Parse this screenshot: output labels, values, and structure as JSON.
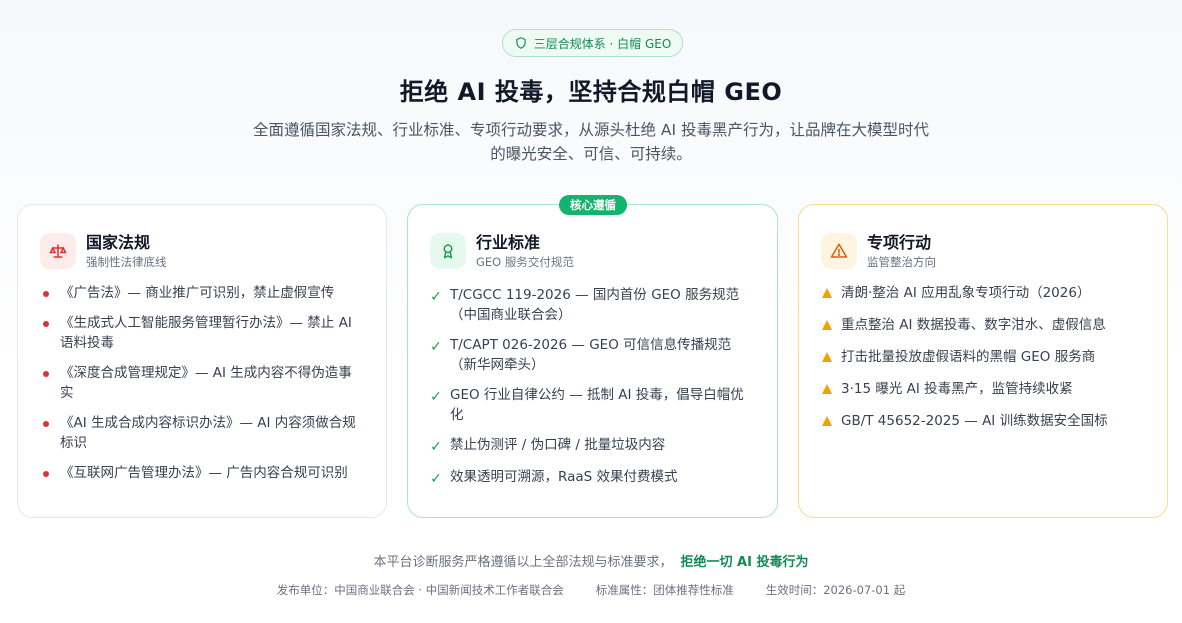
{
  "badge": {
    "icon": "shield-icon",
    "label": "三层合规体系 · 白帽 GEO"
  },
  "hero": {
    "title": "拒绝 AI 投毒，坚持合规白帽 GEO",
    "subtitle": "全面遵循国家法规、行业标准、专项行动要求，从源头杜绝 AI 投毒黑产行为，让品牌在大模型时代的曝光安全、可信、可持续。"
  },
  "cards": [
    {
      "icon": "scale-icon",
      "title": "国家法规",
      "subtitle": "强制性法律底线",
      "items": [
        "《广告法》— 商业推广可识别，禁止虚假宣传",
        "《生成式人工智能服务管理暂行办法》— 禁止 AI 语料投毒",
        "《深度合成管理规定》— AI 生成内容不得伪造事实",
        "《AI 生成合成内容标识办法》— AI 内容须做合规标识",
        "《互联网广告管理办法》— 广告内容合规可识别"
      ]
    },
    {
      "badge": "核心遵循",
      "icon": "award-icon",
      "title": "行业标准",
      "subtitle": "GEO 服务交付规范",
      "items": [
        "T/CGCC 119-2026 — 国内首份 GEO 服务规范（中国商业联合会）",
        "T/CAPT 026-2026 — GEO 可信信息传播规范（新华网牵头）",
        "GEO 行业自律公约 — 抵制 AI 投毒，倡导白帽优化",
        "禁止伪测评 / 伪口碑 / 批量垃圾内容",
        "效果透明可溯源，RaaS 效果付费模式"
      ]
    },
    {
      "icon": "warning-icon",
      "title": "专项行动",
      "subtitle": "监管整治方向",
      "items": [
        "清朗·整治 AI 应用乱象专项行动（2026）",
        "重点整治 AI 数据投毒、数字泔水、虚假信息",
        "打击批量投放虚假语料的黑帽 GEO 服务商",
        "3·15 曝光 AI 投毒黑产，监管持续收紧",
        "GB/T 45652-2025 — AI 训练数据安全国标"
      ]
    }
  ],
  "footer": {
    "statement": "本平台诊断服务严格遵循以上全部法规与标准要求，",
    "emphasis": "拒绝一切 AI 投毒行为",
    "publisher": "发布单位：中国商业联合会 · 中国新闻技术工作者联合会",
    "attribute": "标准属性：团体推荐性标准",
    "effective": "生效时间：2026-07-01 起"
  },
  "colors": {
    "green": "#16b36e",
    "red": "#e03131",
    "orange": "#f59f00"
  }
}
